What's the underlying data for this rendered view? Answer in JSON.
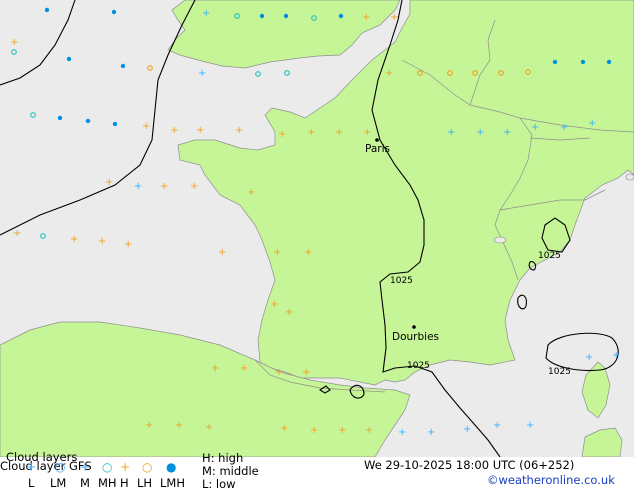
{
  "colors": {
    "sea": "#ebebeb",
    "land": "#c6f597",
    "border": "#8f8f8f",
    "isobar": "#000000",
    "high": "#0090e0",
    "middle": "#20c0c0",
    "mid_high": "#3ab0ff",
    "low": "#f0a020",
    "credit": "#1a3dbf"
  },
  "map": {
    "cities": [
      {
        "name": "Paris"
      },
      {
        "name": "Dourbies"
      }
    ],
    "isobar_labels": [
      "1025",
      "1025",
      "1025",
      "1025"
    ]
  },
  "legend": {
    "title": "Cloud layers",
    "subtitle": "Cloud layer  GFS",
    "symbol_labels": [
      "L",
      "LM",
      "M",
      "MH",
      "H",
      "LH",
      "LMH"
    ],
    "symbol_icons": [
      "plus-icon",
      "open-circle-icon",
      "plus-icon",
      "open-circle-icon",
      "plus-icon",
      "open-circle-icon",
      "filled-dot-icon"
    ],
    "key_high": "H: high",
    "key_middle": "M: middle",
    "key_low": "L: low",
    "datetime": "We 29-10-2025 18:00 UTC (06+252)",
    "credit": "©weatheronline.co.uk"
  }
}
